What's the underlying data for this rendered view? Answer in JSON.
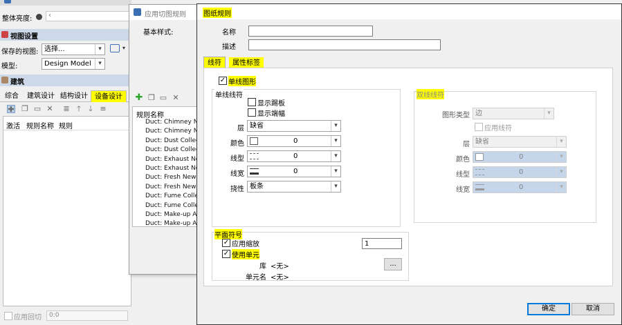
{
  "left_panel": {
    "title_partial": "整体亮度:",
    "brightness_label": "整体亮度:",
    "section_view": "视图设置",
    "saved_view_label": "保存的视图:",
    "saved_view_value": "选择...",
    "model_label": "模型:",
    "model_value": "Design Model",
    "section_arch": "建筑",
    "tabs": [
      "综合",
      "建筑设计",
      "结构设计",
      "设备设计"
    ],
    "columns": [
      "激活",
      "规则名称",
      "规则"
    ],
    "footer_checkbox": "应用回切",
    "footer_value": "0:0"
  },
  "middle_panel": {
    "title": "应用切图规则",
    "base_style_label": "基本样式:",
    "list_header": "规则名称",
    "rules": [
      "Duct: Chimney New",
      "Duct: Chimney New",
      "Duct: Dust Collection",
      "Duct: Dust Collection",
      "Duct: Exhaust New",
      "Duct: Exhaust New",
      "Duct: Fresh New - D",
      "Duct: Fresh New - S",
      "Duct: Fume Collection",
      "Duct: Fume Collection",
      "Duct: Make-up Air N",
      "Duct: Make-up Air N"
    ]
  },
  "dialog": {
    "title": "图纸规则",
    "name_label": "名称",
    "name_value": "",
    "desc_label": "描述",
    "desc_value": "",
    "tabs": [
      "线符",
      "属性标签"
    ],
    "line_graphic": {
      "checked": true,
      "label": "单线图形"
    },
    "single_group": {
      "title": "单线线符",
      "show_skirting": {
        "checked": false,
        "label": "显示踢板"
      },
      "show_end": {
        "checked": false,
        "label": "显示端幅"
      },
      "layer": {
        "label": "层",
        "value": "缺省"
      },
      "color": {
        "label": "颜色",
        "value": "0"
      },
      "linetype": {
        "label": "线型",
        "value": "0"
      },
      "linewidth": {
        "label": "线宽",
        "value": "0"
      },
      "flex": {
        "label": "挠性",
        "value": "板条"
      }
    },
    "double_group": {
      "title": "双线线符",
      "shape_type": {
        "label": "图形类型",
        "value": "边"
      },
      "apply_line": {
        "checked": false,
        "label": "应用线符"
      },
      "layer": {
        "label": "层",
        "value": "缺省"
      },
      "color": {
        "label": "颜色",
        "value": "0"
      },
      "linetype": {
        "label": "线型",
        "value": "0"
      },
      "linewidth": {
        "label": "线宽",
        "value": "0"
      }
    },
    "plane_group": {
      "title": "平面符号",
      "apply_scale": {
        "checked": true,
        "label": "应用缩放",
        "value": "1"
      },
      "use_cell": {
        "checked": true,
        "label": "使用单元"
      },
      "library_label": "库",
      "library_value": "<无>",
      "browse_label": "...",
      "cell_name_label": "单元名",
      "cell_name_value": "<无>"
    },
    "ok_label": "确定",
    "cancel_label": "取消"
  },
  "colors": {
    "highlight": "#ffff00",
    "selection": "#c5d5ea",
    "accent_green": "#2aa52a"
  }
}
